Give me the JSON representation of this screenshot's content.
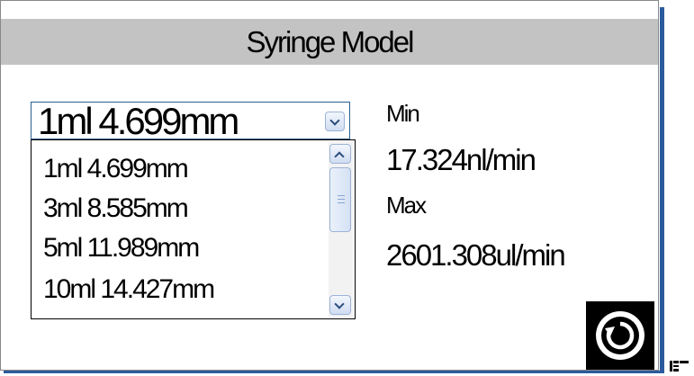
{
  "header": {
    "title": "Syringe Model"
  },
  "combo": {
    "selected": "1ml 4.699mm"
  },
  "dropdown": {
    "items": [
      {
        "label": "1ml  4.699mm"
      },
      {
        "label": "3ml  8.585mm"
      },
      {
        "label": "5ml  11.989mm"
      },
      {
        "label": "10ml 14.427mm"
      }
    ]
  },
  "limits": {
    "min_label": "Min",
    "min_value": "17.324nl/min",
    "max_label": "Max",
    "max_value": "2601.308ul/min"
  },
  "icons": {
    "combo_arrow": "chevron-down-icon",
    "scroll_up": "chevron-up-icon",
    "scroll_down": "chevron-down-icon",
    "back": "back-rotate-icon",
    "cursor": "pointer-cursor-icon"
  },
  "colors": {
    "header_bg": "#c3c3c3",
    "frame_edge": "#2b5a9e",
    "button_bg": "#000000"
  }
}
